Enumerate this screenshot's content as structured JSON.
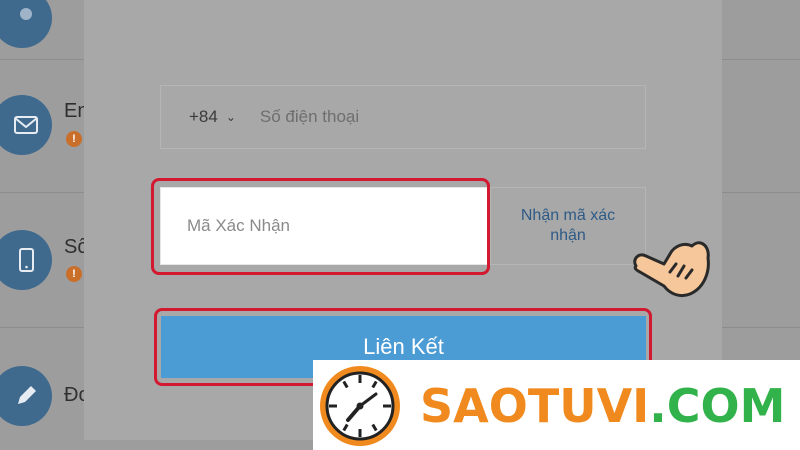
{
  "background": {
    "rows": [
      {
        "label": "",
        "icon": "user-icon",
        "has_warning": false
      },
      {
        "label": "En",
        "icon": "mail-icon",
        "has_warning": true
      },
      {
        "label": "Số",
        "icon": "phone-icon",
        "has_warning": true
      },
      {
        "label": "Đo",
        "icon": "pencil-icon",
        "has_warning": false
      }
    ],
    "warning_glyph": "!"
  },
  "modal": {
    "phone": {
      "country_code": "+84",
      "placeholder": "Số điện thoại"
    },
    "code": {
      "placeholder": "Mã Xác Nhận"
    },
    "get_code_label": "Nhận mã xác nhận",
    "submit_label": "Liên Kết"
  },
  "colors": {
    "highlight": "#d2192f",
    "primary": "#4b9bd4",
    "link": "#2e5a86"
  },
  "watermark": {
    "part1": "SAOTUVI",
    "part2": ".COM"
  }
}
